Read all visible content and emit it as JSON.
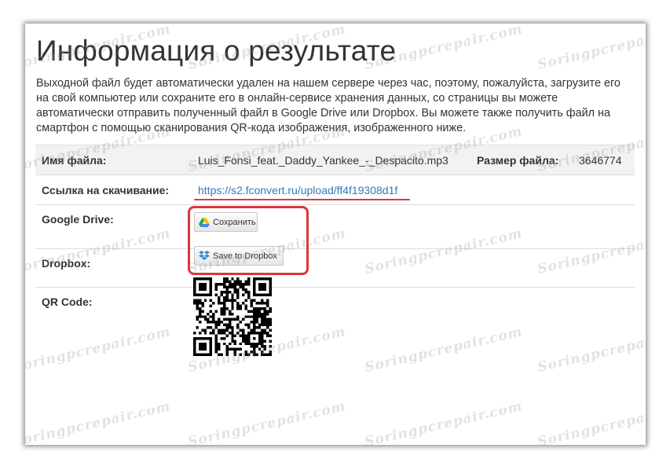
{
  "page": {
    "title": "Информация о результате",
    "description": "Выходной файл будет автоматически удален на нашем сервере через час, поэтому, пожалуйста, загрузите его на свой компьютер или сохраните его в онлайн-сервисе хранения данных, со страницы вы можете автоматически отправить полученный файл в Google Drive или Dropbox. Вы можете также получить файл на смартфон с помощью сканирования QR-кода изображения, изображенного ниже."
  },
  "info": {
    "file_name_label": "Имя файла:",
    "file_name": "Luis_Fonsi_feat._Daddy_Yankee_-_Despacito.mp3",
    "file_size_label": "Размер файла:",
    "file_size": "3646774",
    "download_label": "Ссылка на скачивание:",
    "download_link": "https://s2.fconvert.ru/upload/ff4f19308d1f",
    "gdrive_label": "Google Drive:",
    "gdrive_button": "Сохранить",
    "dropbox_label": "Dropbox:",
    "dropbox_button": "Save to Dropbox",
    "qr_label": "QR Code:"
  },
  "watermark": "Soringpcrepair.com",
  "icons": {
    "google_drive": "google-drive-icon",
    "dropbox": "dropbox-icon"
  },
  "colors": {
    "link": "#337ab7",
    "highlight": "#d9363e",
    "text": "#333333"
  }
}
